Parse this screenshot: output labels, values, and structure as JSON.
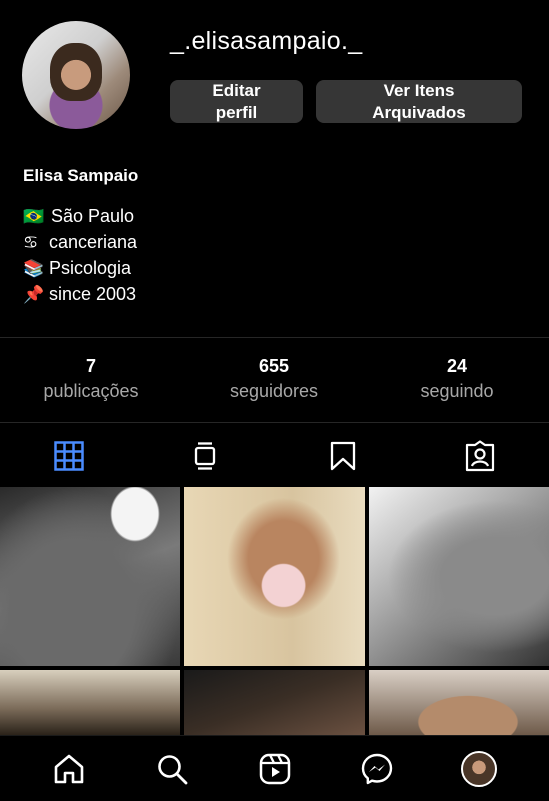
{
  "profile": {
    "username": "_.elisasampaio._",
    "full_name": "Elisa Sampaio",
    "bio": [
      {
        "icon": "brazil-flag-icon",
        "emoji": "🇧🇷",
        "text": "São Paulo"
      },
      {
        "icon": "cancer-sign-icon",
        "emoji": "♋",
        "text": "canceriana"
      },
      {
        "icon": "books-icon",
        "emoji": "📚",
        "text": "Psicologia"
      },
      {
        "icon": "pushpin-icon",
        "emoji": "📌",
        "text": "since 2003"
      }
    ]
  },
  "buttons": {
    "edit_profile_line1": "Editar",
    "edit_profile_line2": "perfil",
    "archived_line1": "Ver Itens",
    "archived_line2": "Arquivados"
  },
  "stats": [
    {
      "value": "7",
      "label": "publicações"
    },
    {
      "value": "655",
      "label": "seguidores"
    },
    {
      "value": "24",
      "label": "seguindo"
    }
  ],
  "tabs": [
    {
      "icon": "grid-icon",
      "active": true,
      "color": "#4a8cff"
    },
    {
      "icon": "reels-feed-icon",
      "active": false
    },
    {
      "icon": "bookmark-icon",
      "active": false
    },
    {
      "icon": "tagged-icon",
      "active": false
    }
  ],
  "nav": [
    {
      "icon": "home-icon"
    },
    {
      "icon": "search-icon"
    },
    {
      "icon": "reels-icon"
    },
    {
      "icon": "messenger-icon"
    },
    {
      "icon": "profile-avatar"
    }
  ]
}
